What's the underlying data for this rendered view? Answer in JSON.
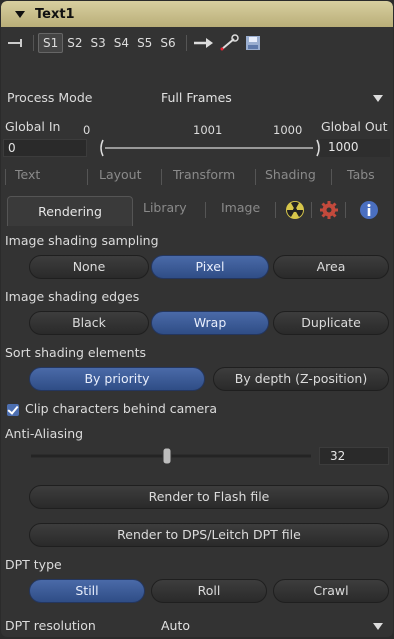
{
  "node": {
    "title": "Text1"
  },
  "toolbar": {
    "slots": [
      "S1",
      "S2",
      "S3",
      "S4",
      "S5",
      "S6"
    ],
    "active_slot": "S1"
  },
  "process_mode": {
    "label": "Process Mode",
    "value": "Full Frames"
  },
  "range": {
    "global_in_label": "Global In",
    "global_out_label": "Global Out",
    "global_in_value": "0",
    "global_out_value": "1000",
    "min_tick": "0",
    "current_tick": "1001",
    "max_tick": "1000"
  },
  "tabs_row1": [
    "Text",
    "Layout",
    "Transform",
    "Shading",
    "Tabs"
  ],
  "tabs_row2": {
    "active": "Rendering",
    "items": [
      "Library",
      "Image"
    ]
  },
  "image_shading_sampling": {
    "label": "Image shading sampling",
    "options": [
      "None",
      "Pixel",
      "Area"
    ],
    "selected": "Pixel"
  },
  "image_shading_edges": {
    "label": "Image shading edges",
    "options": [
      "Black",
      "Wrap",
      "Duplicate"
    ],
    "selected": "Wrap"
  },
  "sort_shading": {
    "label": "Sort shading elements",
    "options": [
      "By priority",
      "By depth (Z-position)"
    ],
    "selected": "By priority"
  },
  "clip_characters": {
    "label": "Clip characters behind camera",
    "checked": true
  },
  "anti_aliasing": {
    "label": "Anti-Aliasing",
    "value": "32"
  },
  "buttons": {
    "render_flash": "Render to Flash file",
    "render_dps": "Render to DPS/Leitch DPT file"
  },
  "dpt_type": {
    "label": "DPT type",
    "options": [
      "Still",
      "Roll",
      "Crawl"
    ],
    "selected": "Still"
  },
  "dpt_resolution": {
    "label": "DPT resolution",
    "value": "Auto"
  }
}
